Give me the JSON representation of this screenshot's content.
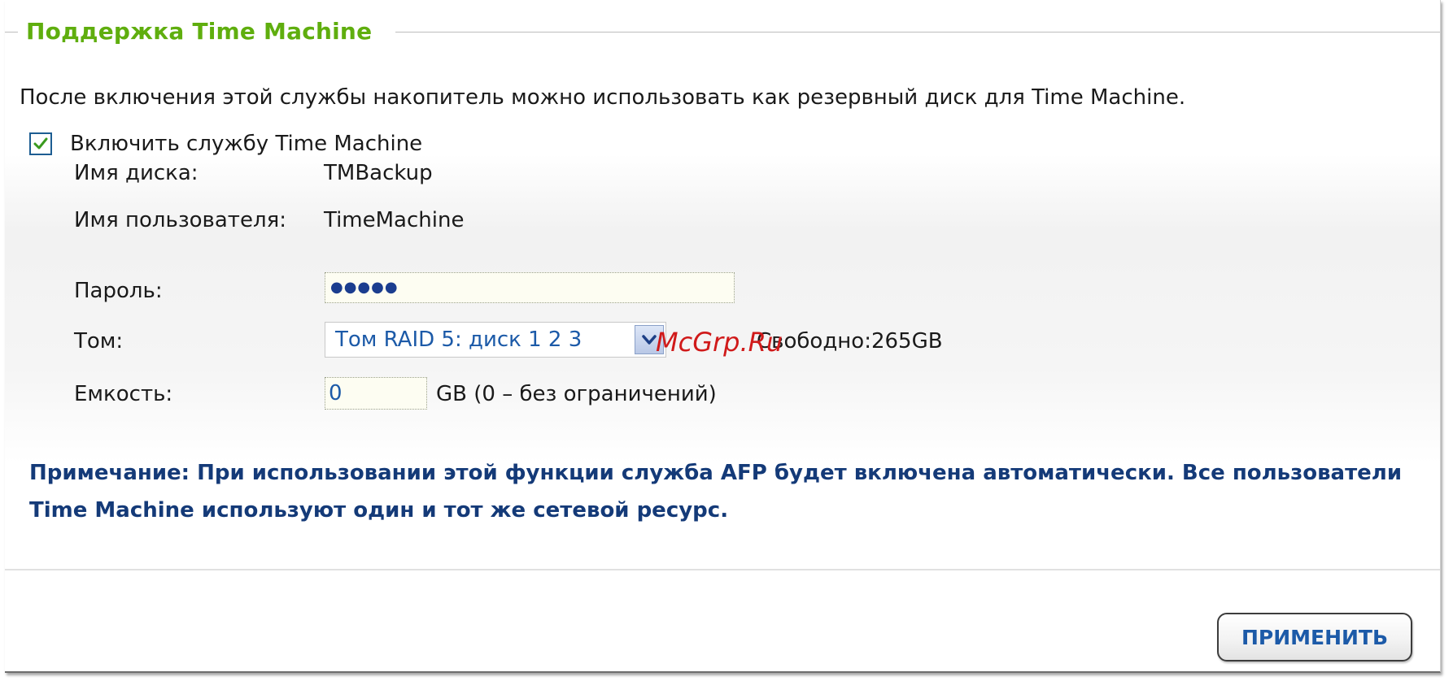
{
  "section": {
    "title": "Поддержка Time Machine",
    "description": "После включения этой службы накопитель можно использовать как резервный диск для Time Machine."
  },
  "enable": {
    "label": "Включить службу Time Machine",
    "checked": true
  },
  "fields": {
    "disk_name": {
      "label": "Имя диска:",
      "value": "TMBackup"
    },
    "user_name": {
      "label": "Имя пользователя:",
      "value": "TimeMachine"
    },
    "password": {
      "label": "Пароль:",
      "value": "●●●●●"
    },
    "volume": {
      "label": "Том:",
      "selected": "Том RAID 5: диск 1 2 3",
      "free": "Свободно:265GB"
    },
    "capacity": {
      "label": "Емкость:",
      "value": "0",
      "hint": "GB (0 – без ограничений)"
    }
  },
  "note": "Примечание: При использовании этой функции служба AFP будет включена автоматически. Все пользователи Time Machine используют один и тот же сетевой ресурс.",
  "watermark": "McGrp.Ru",
  "buttons": {
    "apply": "ПРИМЕНИТЬ"
  },
  "colors": {
    "title": "#5fae0e",
    "note": "#143a78",
    "link_value": "#1c5aa8",
    "checkbox_check": "#3a9a1e"
  },
  "icons": {
    "checkbox": "checkmark-icon",
    "select_arrow": "chevron-down-icon"
  }
}
